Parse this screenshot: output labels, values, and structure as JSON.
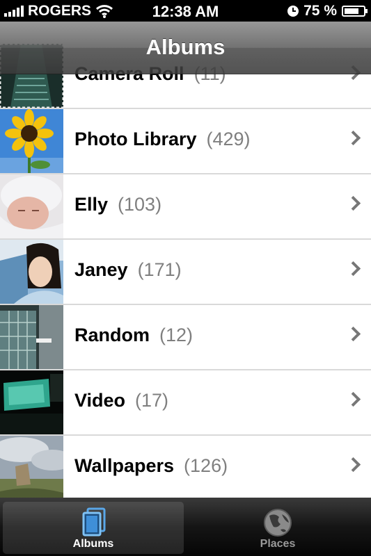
{
  "status_bar": {
    "carrier": "ROGERS",
    "time": "12:38 AM",
    "battery_percent": "75 %",
    "battery_level": 0.75,
    "signal_bars": 5,
    "icons": [
      "signal-bars-icon",
      "wifi-icon",
      "clock-icon",
      "battery-charging-icon"
    ]
  },
  "nav": {
    "title": "Albums"
  },
  "albums": [
    {
      "name": "Camera Roll",
      "count": "(11)",
      "thumb": "escalator-photo"
    },
    {
      "name": "Photo Library",
      "count": "(429)",
      "thumb": "sunflower-photo"
    },
    {
      "name": "Elly",
      "count": "(103)",
      "thumb": "baby-photo"
    },
    {
      "name": "Janey",
      "count": "(171)",
      "thumb": "woman-portrait-photo"
    },
    {
      "name": "Random",
      "count": "(12)",
      "thumb": "building-photo"
    },
    {
      "name": "Video",
      "count": "(17)",
      "thumb": "theater-screen-photo"
    },
    {
      "name": "Wallpapers",
      "count": "(126)",
      "thumb": "landscape-sky-photo"
    }
  ],
  "tabs": [
    {
      "label": "Albums",
      "icon": "albums-icon",
      "selected": true
    },
    {
      "label": "Places",
      "icon": "globe-icon",
      "selected": false
    }
  ],
  "colors": {
    "accent": "#5aa7e8",
    "count_text": "#7f7f7f",
    "separator": "#d9d9d9"
  }
}
